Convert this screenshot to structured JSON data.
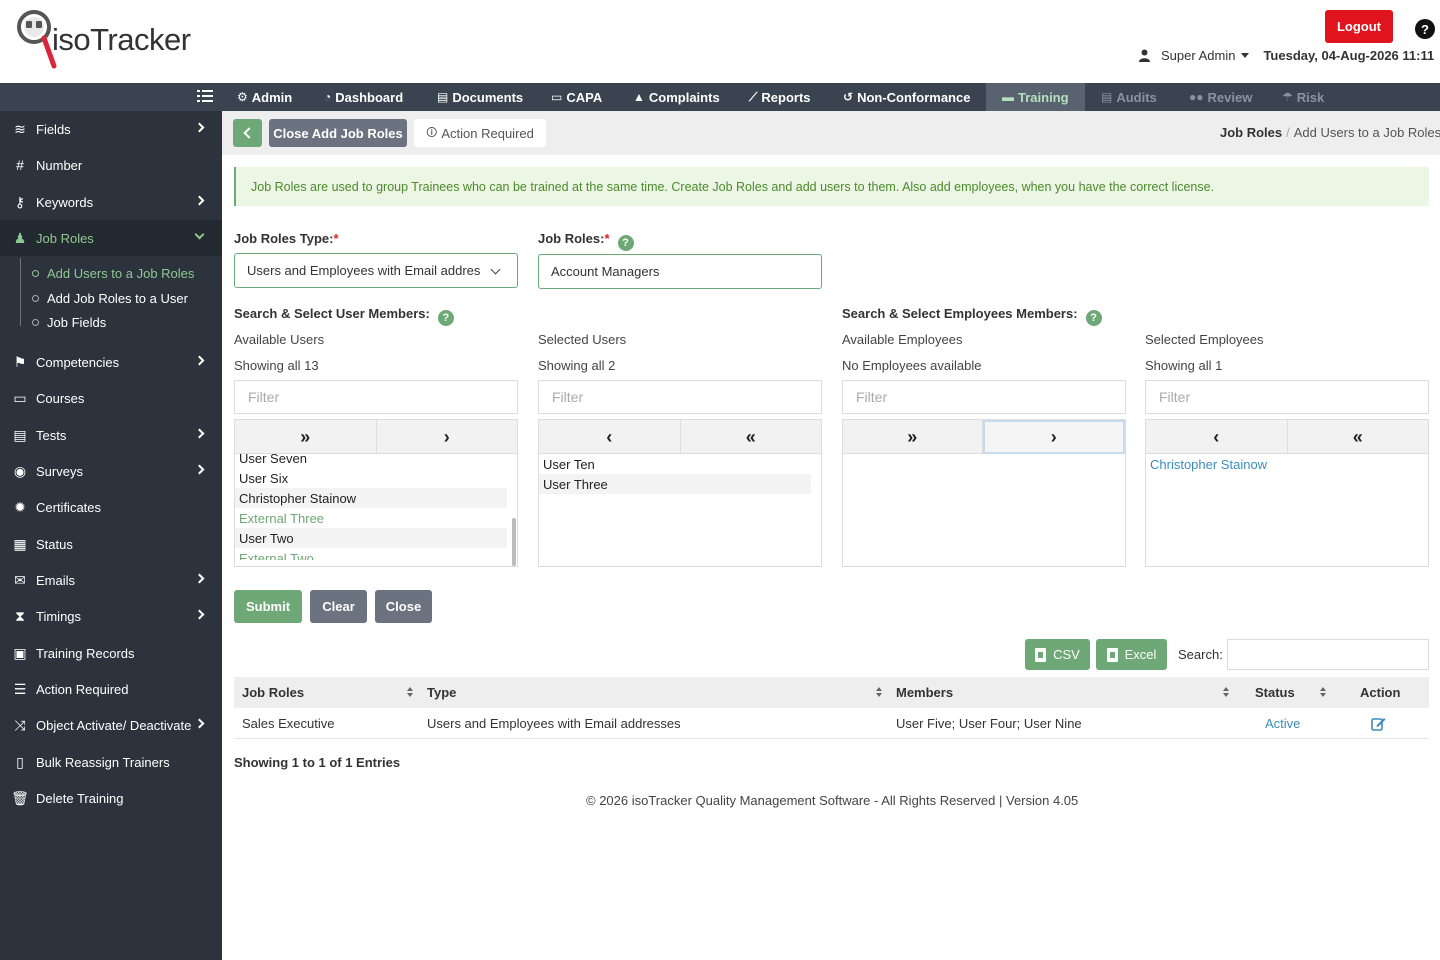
{
  "app": {
    "logo_text": "isoTracker"
  },
  "header": {
    "logout_label": "Logout",
    "help_label": "?",
    "user_name": "Super Admin",
    "datetime": "Tuesday, 04-Aug-2026 11:11"
  },
  "topnav": {
    "items": [
      {
        "label": "Admin",
        "icon": "gear-icon"
      },
      {
        "label": "Dashboard",
        "icon": "dashboard-icon"
      },
      {
        "label": "Documents",
        "icon": "document-icon"
      },
      {
        "label": "CAPA",
        "icon": "capa-icon"
      },
      {
        "label": "Complaints",
        "icon": "warning-icon"
      },
      {
        "label": "Reports",
        "icon": "chart-icon"
      },
      {
        "label": "Non-Conformance",
        "icon": "history-icon"
      },
      {
        "label": "Training",
        "icon": "training-icon"
      },
      {
        "label": "Audits",
        "icon": "audit-icon"
      },
      {
        "label": "Review",
        "icon": "review-icon"
      },
      {
        "label": "Risk",
        "icon": "risk-icon"
      }
    ]
  },
  "sidebar": {
    "items": [
      {
        "label": "Fields",
        "icon": "layers-icon"
      },
      {
        "label": "Number",
        "icon": "hash-icon"
      },
      {
        "label": "Keywords",
        "icon": "key-icon"
      },
      {
        "label": "Job Roles",
        "icon": "user-tie-icon"
      },
      {
        "label": "Competencies",
        "icon": "competency-icon"
      },
      {
        "label": "Courses",
        "icon": "course-icon"
      },
      {
        "label": "Tests",
        "icon": "test-icon"
      },
      {
        "label": "Surveys",
        "icon": "survey-icon"
      },
      {
        "label": "Certificates",
        "icon": "certificate-icon"
      },
      {
        "label": "Status",
        "icon": "calendar-check-icon"
      },
      {
        "label": "Emails",
        "icon": "envelope-icon"
      },
      {
        "label": "Timings",
        "icon": "hourglass-icon"
      },
      {
        "label": "Training Records",
        "icon": "records-icon"
      },
      {
        "label": "Action Required",
        "icon": "list-check-icon"
      },
      {
        "label": "Object Activate/ Deactivate",
        "icon": "shuffle-icon"
      },
      {
        "label": "Bulk Reassign Trainers",
        "icon": "reassign-icon"
      },
      {
        "label": "Delete Training",
        "icon": "trash-icon"
      }
    ],
    "sub_items": [
      {
        "label": "Add Users to a Job Roles"
      },
      {
        "label": "Add Job Roles to a User"
      },
      {
        "label": "Job Fields"
      }
    ]
  },
  "toolbar": {
    "close_label": "Close Add Job Roles",
    "action_required_label": "Action Required"
  },
  "breadcrumb": {
    "root": "Job Roles",
    "separator": "/",
    "current": "Add Users to a Job Roles"
  },
  "banner": {
    "text": "Job Roles are used to group Trainees who can be trained at the same time. Create Job Roles and add users to them. Also add employees, when you have the correct license."
  },
  "form": {
    "type_label": "Job Roles Type:",
    "roles_label": "Job Roles:",
    "required_mark": "*",
    "type_value": "Users and Employees with Email addres",
    "roles_value": "Account Managers",
    "user_members_label": "Search & Select User Members:",
    "employee_members_label": "Search & Select Employees Members:"
  },
  "lists": {
    "available_users": {
      "title": "Available Users",
      "count_text": "Showing all 13",
      "filter_placeholder": "Filter",
      "items": [
        "User Seven",
        "User Six",
        "Christopher Stainow",
        "External Three",
        "User Two",
        "External Two"
      ]
    },
    "selected_users": {
      "title": "Selected Users",
      "count_text": "Showing all 2",
      "filter_placeholder": "Filter",
      "items": [
        "User Ten",
        "User Three"
      ]
    },
    "available_employees": {
      "title": "Available Employees",
      "count_text": "No Employees available",
      "filter_placeholder": "Filter",
      "items": []
    },
    "selected_employees": {
      "title": "Selected Employees",
      "count_text": "Showing all 1",
      "filter_placeholder": "Filter",
      "items": [
        "Christopher Stainow"
      ]
    }
  },
  "buttons": {
    "submit": "Submit",
    "clear": "Clear",
    "close": "Close",
    "csv": "CSV",
    "excel": "Excel",
    "search_label": "Search:"
  },
  "table": {
    "columns": [
      "Job Roles",
      "Type",
      "Members",
      "Status",
      "Action"
    ],
    "rows": [
      {
        "job_role": "Sales Executive",
        "type": "Users and Employees with Email addresses",
        "members": "User Five; User Four; User Nine",
        "status": "Active"
      }
    ],
    "entries_text": "Showing 1 to 1 of 1 Entries"
  },
  "footer": {
    "text": "© 2026 isoTracker Quality Management Software - All Rights Reserved | Version 4.05"
  },
  "colors": {
    "accent": "#6fa877",
    "danger": "#e0141f",
    "sidebar": "#2c333d",
    "nav": "#3a4350",
    "link": "#3c8dbc"
  }
}
